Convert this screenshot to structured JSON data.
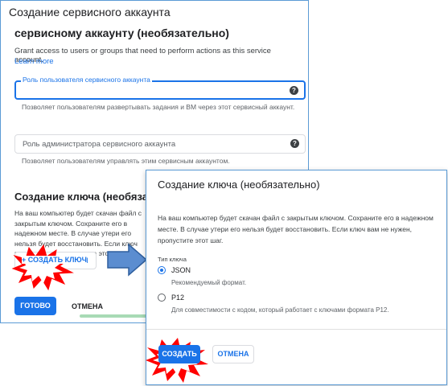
{
  "back_window": {
    "title": "Создание сервисного аккаунта",
    "section_heading": "сервисному аккаунту (необязательно)",
    "grant_desc": "Grant access to users or groups that need to perform actions as this service account.",
    "learn_more": "Learn more",
    "role_user_field": {
      "label": "Роль пользователя сервисного аккаунта",
      "hint": "Позволяет пользователям развертывать задания и ВМ через этот сервисный аккаунт."
    },
    "role_admin_field": {
      "placeholder": "Роль администратора сервисного аккаунта",
      "hint": "Позволяет пользователям управлять этим сервисным аккаунтом."
    },
    "key_heading": "Создание ключа (необязательно)",
    "key_text": "На ваш компьютер будет скачан файл с закрытым ключом. Сохраните его в надежном месте. В случае утери его нельзя будет восстановить. Если ключ вам не нужен, пропустите этот шаг.",
    "create_key_button": "+ СОЗДАТЬ КЛЮЧ",
    "done_button": "ГОТОВО",
    "cancel_button": "ОТМЕНА"
  },
  "dialog": {
    "title": "Создание ключа (необязательно)",
    "description": "На ваш компьютер будет скачан файл с закрытым ключом. Сохраните его в надежном месте. В случае утери его нельзя будет восстановить. Если ключ вам не нужен, пропустите этот шаг.",
    "key_type_label": "Тип ключа",
    "options": [
      {
        "label": "JSON",
        "sub": "Рекомендуемый формат.",
        "selected": true
      },
      {
        "label": "P12",
        "sub": "Для совместимости с кодом, который работает с ключами формата P12.",
        "selected": false
      }
    ],
    "create_button": "СОЗДАТЬ",
    "cancel_button": "ОТМЕНА"
  },
  "colors": {
    "accent": "#1a73e8",
    "highlight_burst": "#ff0000",
    "arrow": "#4a7ebb"
  }
}
